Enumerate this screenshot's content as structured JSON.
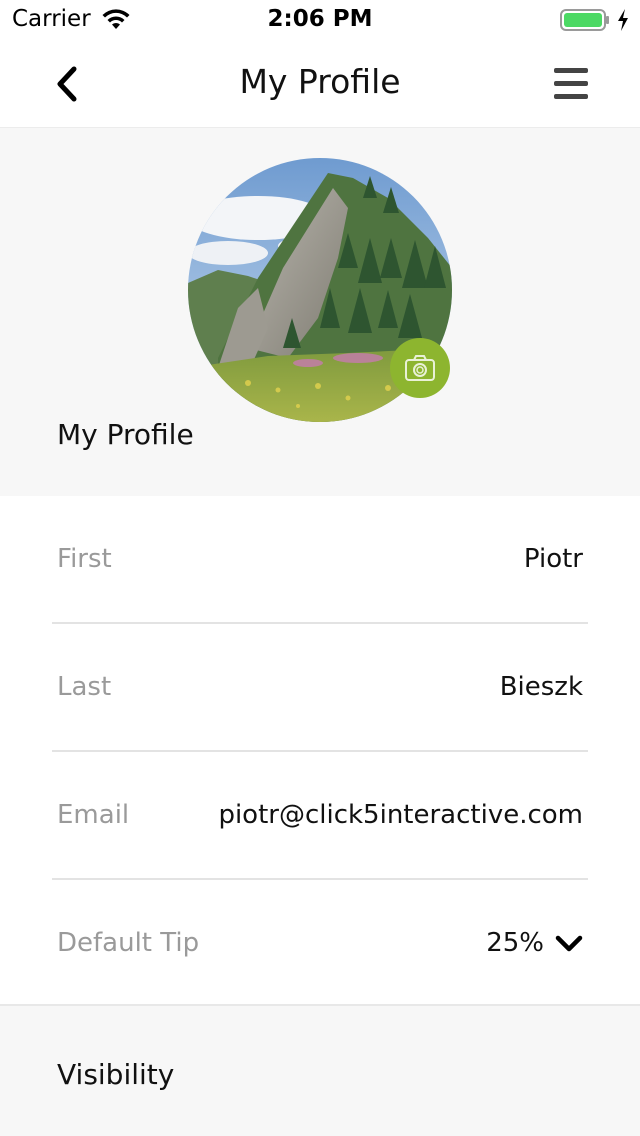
{
  "status_bar": {
    "carrier": "Carrier",
    "time": "2:06 PM",
    "battery_color": "#4cd964"
  },
  "nav": {
    "title": "My Profile",
    "back_icon": "chevron-left-icon",
    "menu_icon": "hamburger-menu-icon"
  },
  "profile": {
    "section_title": "My Profile",
    "avatar_icon": "mountain-landscape-photo",
    "camera_icon": "camera-icon",
    "accent_color": "#8db52f"
  },
  "form": {
    "fields": [
      {
        "label": "First",
        "value": "Piotr"
      },
      {
        "label": "Last",
        "value": "Bieszk"
      },
      {
        "label": "Email",
        "value": "piotr@click5interactive.com"
      }
    ],
    "tip": {
      "label": "Default Tip",
      "value": "25%",
      "icon": "chevron-down-icon"
    }
  },
  "visibility": {
    "title": "Visibility"
  }
}
